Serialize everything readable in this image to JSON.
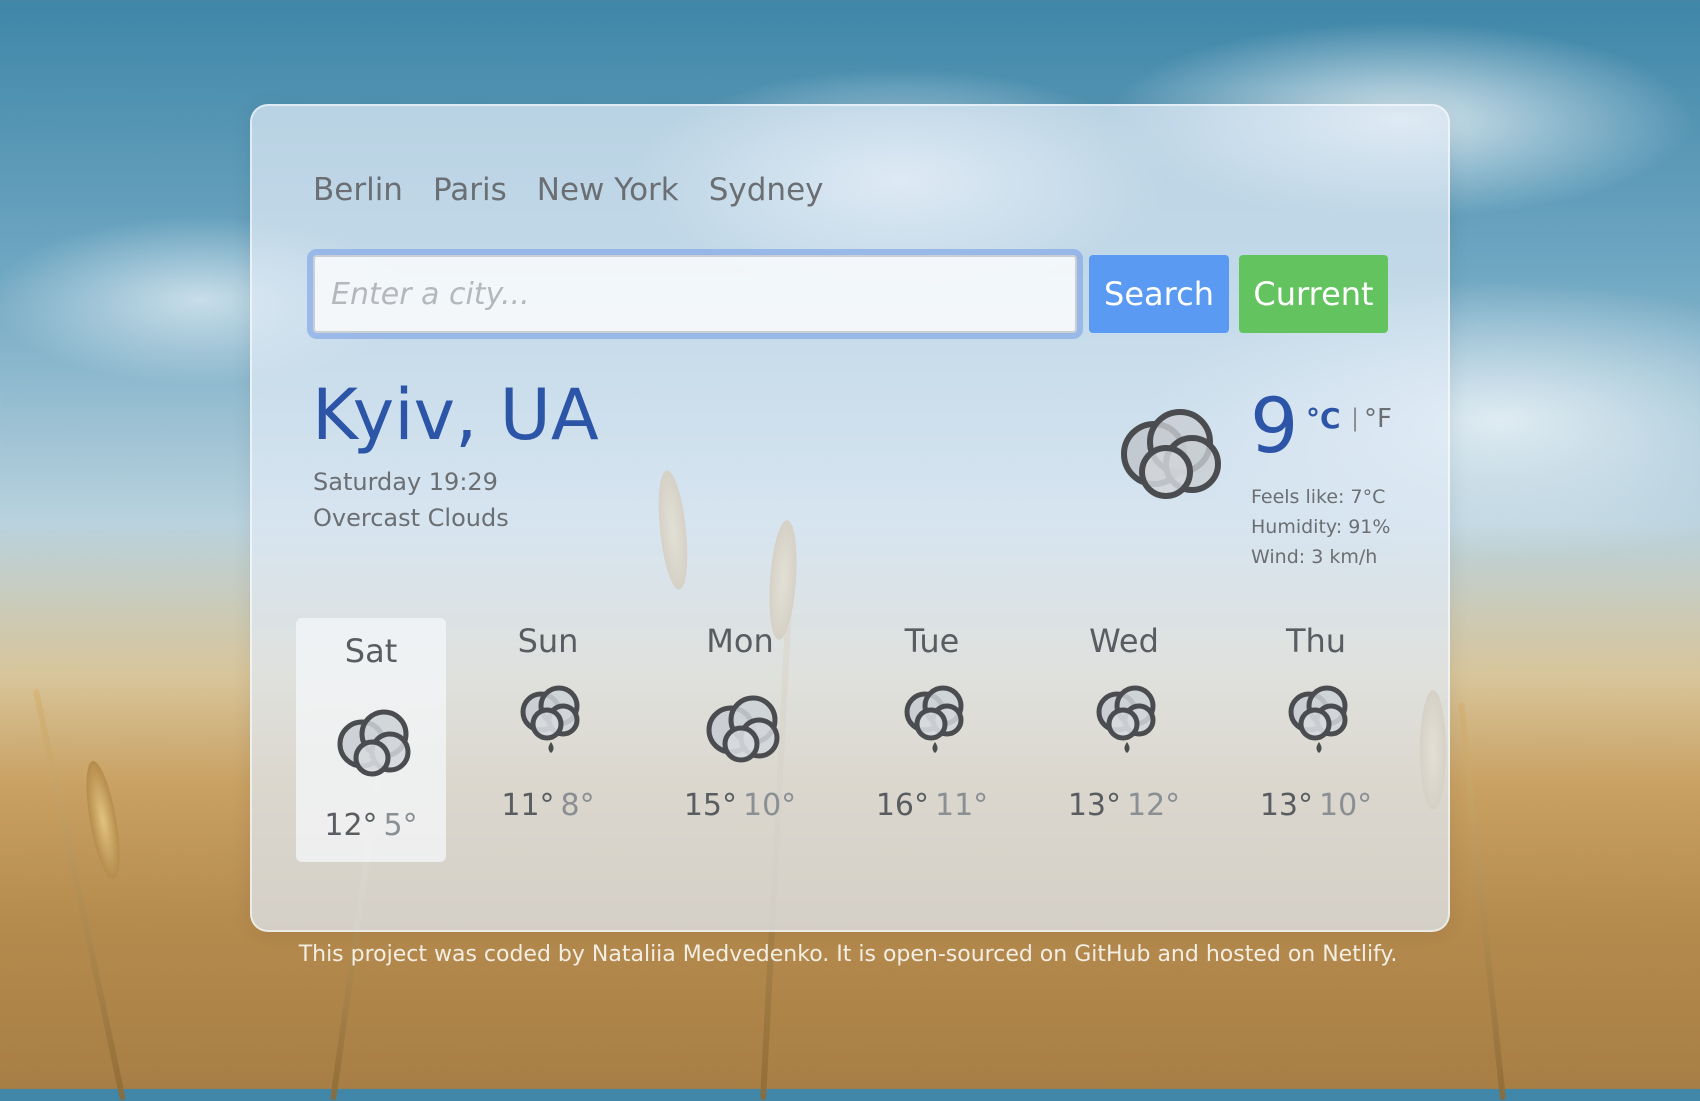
{
  "quick_links": [
    "Berlin",
    "Paris",
    "New York",
    "Sydney"
  ],
  "search": {
    "placeholder": "Enter a city...",
    "search_label": "Search",
    "current_label": "Current"
  },
  "current": {
    "city": "Kyiv, UA",
    "datetime": "Saturday 19:29",
    "description": "Overcast Clouds",
    "temperature": "9",
    "unit_c": "°C",
    "unit_separator": "|",
    "unit_f": "°F",
    "feels_like": "Feels like: 7°C",
    "humidity": "Humidity: 91%",
    "wind": "Wind: 3 km/h",
    "icon": "overcast-cloud-icon"
  },
  "forecast": [
    {
      "day": "Sat",
      "max": "12°",
      "min": "5°",
      "icon": "cloud-icon"
    },
    {
      "day": "Sun",
      "max": "11°",
      "min": "8°",
      "icon": "rain-cloud-icon"
    },
    {
      "day": "Mon",
      "max": "15°",
      "min": "10°",
      "icon": "cloud-icon"
    },
    {
      "day": "Tue",
      "max": "16°",
      "min": "11°",
      "icon": "rain-cloud-icon"
    },
    {
      "day": "Wed",
      "max": "13°",
      "min": "12°",
      "icon": "rain-cloud-icon"
    },
    {
      "day": "Thu",
      "max": "13°",
      "min": "10°",
      "icon": "rain-cloud-icon"
    }
  ],
  "footer": {
    "p1": "This project was coded by ",
    "author": "Nataliia Medvedenko",
    "p2": ". It is ",
    "open_source": "open-sourced on GitHub",
    "p3": " and hosted on ",
    "host": "Netlify",
    "p4": "."
  },
  "colors": {
    "accent": "#2c55a8",
    "search_button": "#5b9af3",
    "current_button": "#63c45f"
  }
}
